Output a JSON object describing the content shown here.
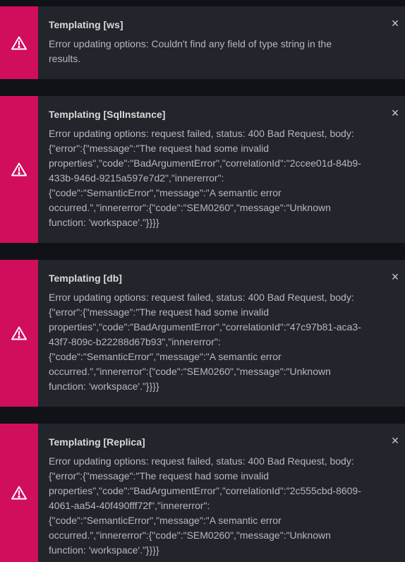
{
  "toasts": [
    {
      "title": "Templating [ws]",
      "lines": [
        "Error updating options: Couldn't find any field of type string in the",
        "results."
      ],
      "close": "×"
    },
    {
      "title": "Templating [SqlInstance]",
      "lines": [
        "Error updating options: request failed, status: 400 Bad Request, body:",
        "{\"error\":{\"message\":\"The request had some invalid",
        "properties\",\"code\":\"BadArgumentError\",\"correlationId\":\"2ccee01d-84b9-",
        "433b-946d-9215a597e7d2\",\"innererror\":",
        "{\"code\":\"SemanticError\",\"message\":\"A semantic error",
        "occurred.\",\"innererror\":{\"code\":\"SEM0260\",\"message\":\"Unknown",
        "function: 'workspace'.\"}}}}"
      ],
      "close": "×"
    },
    {
      "title": "Templating [db]",
      "lines": [
        "Error updating options: request failed, status: 400 Bad Request, body:",
        "{\"error\":{\"message\":\"The request had some invalid",
        "properties\",\"code\":\"BadArgumentError\",\"correlationId\":\"47c97b81-aca3-",
        "43f7-809c-b22288d67b93\",\"innererror\":",
        "{\"code\":\"SemanticError\",\"message\":\"A semantic error",
        "occurred.\",\"innererror\":{\"code\":\"SEM0260\",\"message\":\"Unknown",
        "function: 'workspace'.\"}}}}"
      ],
      "close": "×"
    },
    {
      "title": "Templating [Replica]",
      "lines": [
        "Error updating options: request failed, status: 400 Bad Request, body:",
        "{\"error\":{\"message\":\"The request had some invalid",
        "properties\",\"code\":\"BadArgumentError\",\"correlationId\":\"2c555cbd-8609-",
        "4061-aa54-40f490fff72f\",\"innererror\":",
        "{\"code\":\"SemanticError\",\"message\":\"A semantic error",
        "occurred.\",\"innererror\":{\"code\":\"SEM0260\",\"message\":\"Unknown",
        "function: 'workspace'.\"}}}}"
      ],
      "close": "×"
    }
  ],
  "colors": {
    "accent_error": "#d10e5c",
    "toast_bg": "#22252b",
    "page_bg": "#111217"
  },
  "icons": {
    "toast_icon": "exclamation-triangle-icon",
    "close_icon": "close-icon"
  }
}
